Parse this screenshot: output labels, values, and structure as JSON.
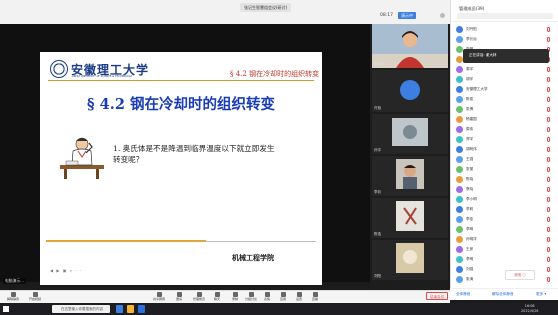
{
  "window": {
    "title": "张记生智慧组会议(研讨)"
  },
  "meeting": {
    "timer": "08:17",
    "mode_label": "演示中",
    "participant_tab": "管理成员(39)"
  },
  "slide": {
    "university_cn": "安徽理工大学",
    "university_en": "ANHUI UNIVERSITY OF SCIENCE & TECHNOLOGY",
    "section_header": "§ 4.2 钢在冷却时的组织转变",
    "title": "§ 4.2 钢在冷却时的组织转变",
    "question": "1. 奥氏体是不是降温到临界温度以下就立即发生转变呢？",
    "department": "机械工程学院"
  },
  "share": {
    "presenter_tag": "电脑演示...",
    "mini_icons": "◀ ▶ ▣ ⌕ ···"
  },
  "video_tiles": [
    {
      "name": "谢大林",
      "type": "camera"
    },
    {
      "name": "许旭",
      "type": "avatar",
      "label": "许旭"
    },
    {
      "name": "孙宇",
      "type": "camera"
    },
    {
      "name": "李钊",
      "type": "camera"
    },
    {
      "name": "陈浩",
      "type": "camera"
    },
    {
      "name": "刘阳",
      "type": "camera"
    },
    {
      "name": "邢强",
      "type": "camera"
    }
  ],
  "panel": {
    "title": "管理成员(39)",
    "popup": "正在讲话: 谢大林",
    "participants": [
      "刘丹阳",
      "李长远",
      "张明",
      "Ruifeng",
      "周宇",
      "胡宇",
      "安徽理工大学",
      "陈俊",
      "张博",
      "杨建国",
      "周伟",
      "郑宇",
      "胡阿伟",
      "王强",
      "张丽",
      "陈晓",
      "蔡晓",
      "李小明",
      "李莉",
      "李佳",
      "李明",
      "孙明洋",
      "王彦",
      "李明",
      "刘强",
      "张涛"
    ],
    "foot_left": "全体静音",
    "foot_mid": "解除全体静音",
    "foot_right": "更多 ▾"
  },
  "float_widget": "邀请 ⓘ",
  "toolbar": {
    "items": [
      "解除静音",
      "开启视频",
      "共享屏幕",
      "邀请",
      "管理成员",
      "聊天",
      "录制",
      "分组讨论",
      "表情",
      "应用",
      "设置",
      "直播"
    ],
    "end_label": "结束会议"
  },
  "taskbar": {
    "search_placeholder": "在这里输入你要搜索的内容",
    "time": "16:08",
    "date": "2022/4/26"
  },
  "colors": {
    "accent": "#3d7fe0",
    "slide_title": "#1a3bb8",
    "slide_header": "#c0392b",
    "end": "#e04a4a"
  }
}
